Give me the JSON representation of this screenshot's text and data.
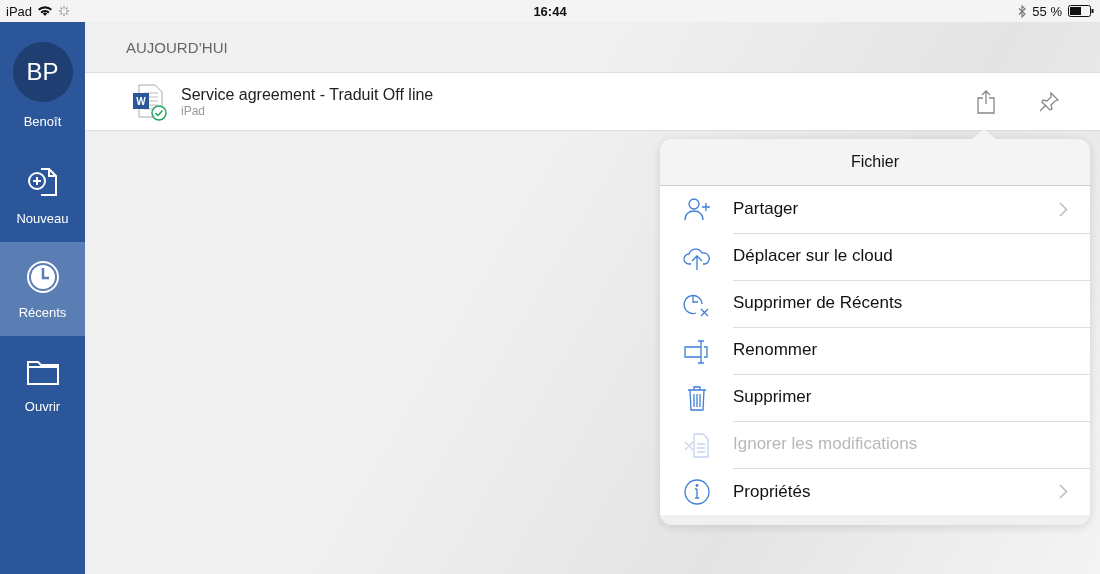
{
  "status_bar": {
    "device": "iPad",
    "time": "16:44",
    "battery": "55 %"
  },
  "sidebar": {
    "account": {
      "initials": "BP",
      "name": "Benoît"
    },
    "items": [
      {
        "label": "Nouveau",
        "kind": "new",
        "selected": false
      },
      {
        "label": "Récents",
        "kind": "recent",
        "selected": true
      },
      {
        "label": "Ouvrir",
        "kind": "open",
        "selected": false
      }
    ]
  },
  "section": {
    "title": "AUJOURD’HUI"
  },
  "files": [
    {
      "name": "Service agreement - Traduit Off line",
      "location": "iPad",
      "icon_letter": "W"
    }
  ],
  "menu": {
    "title": "Fichier",
    "items": [
      {
        "label": "Partager",
        "kind": "share",
        "disabled": false,
        "chevron": true
      },
      {
        "label": "Déplacer sur le cloud",
        "kind": "cloud",
        "disabled": false,
        "chevron": false
      },
      {
        "label": "Supprimer de Récents",
        "kind": "remove-recent",
        "disabled": false,
        "chevron": false
      },
      {
        "label": "Renommer",
        "kind": "rename",
        "disabled": false,
        "chevron": false
      },
      {
        "label": "Supprimer",
        "kind": "delete",
        "disabled": false,
        "chevron": false
      },
      {
        "label": "Ignorer les modifications",
        "kind": "discard",
        "disabled": true,
        "chevron": false
      },
      {
        "label": "Propriétés",
        "kind": "info",
        "disabled": false,
        "chevron": true
      }
    ]
  }
}
